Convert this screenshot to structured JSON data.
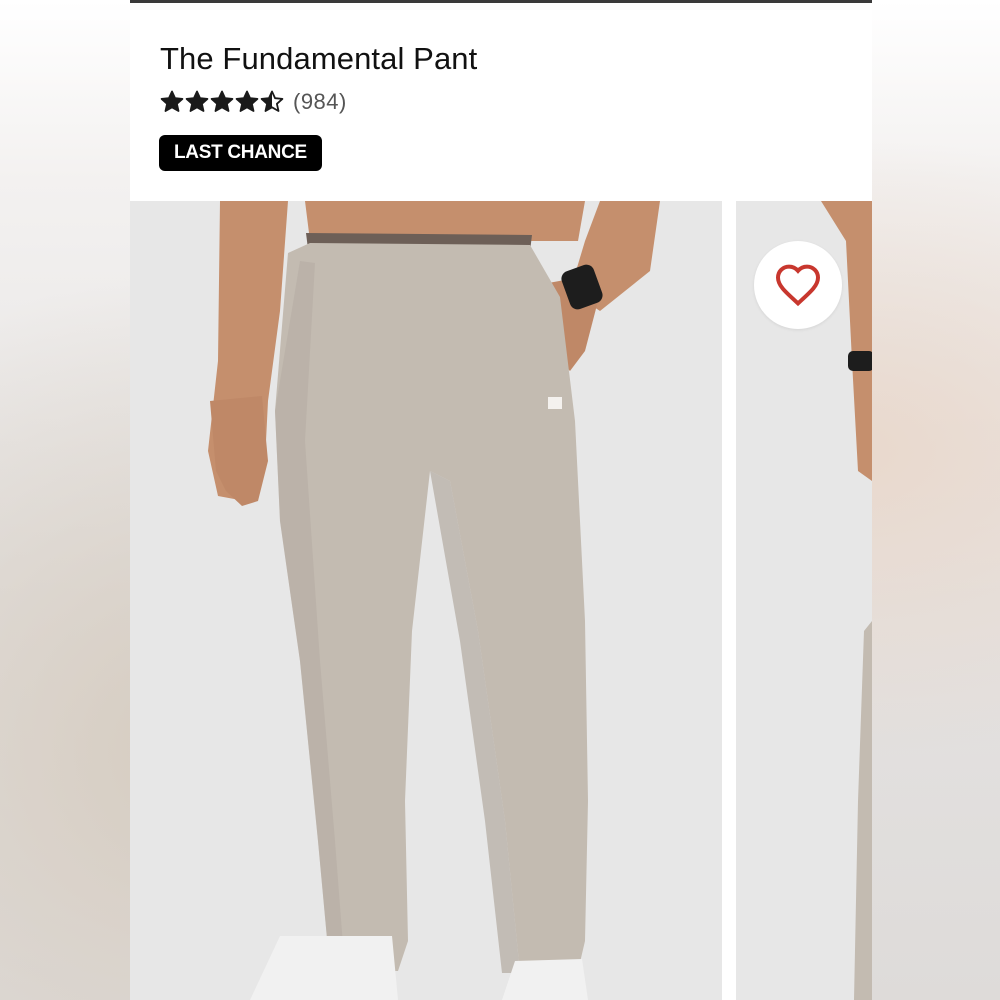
{
  "product": {
    "title": "The Fundamental Pant",
    "rating": 4.5,
    "rating_max": 5,
    "review_count": "(984)",
    "badge": "LAST CHANCE"
  },
  "gallery": {
    "images": [
      {
        "alt": "model wearing pant front view"
      },
      {
        "alt": "model wearing pant next image"
      }
    ],
    "favorite_icon": "heart-outline-icon"
  },
  "colors": {
    "badge_bg": "#000000",
    "heart": "#c8372e",
    "pant": "#c3bbb1",
    "photo_bg": "#e7e7e7"
  }
}
